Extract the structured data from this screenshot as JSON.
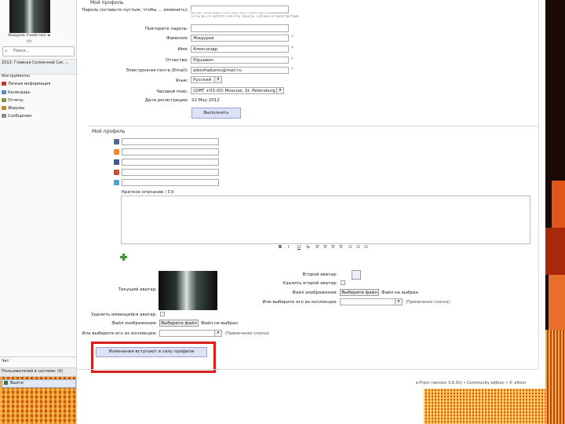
{
  "sidebar": {
    "avatar_label": "Жадуров (Свойства) ◂▸",
    "status": "(P)",
    "search_placeholder": "Поиск...",
    "section_title": "2012: Главная Солнечной Сис ...",
    "tools_title": "Инструменты",
    "nav": [
      {
        "label": "Личная информация",
        "icon": "profile-icon",
        "color": "#c0392b"
      },
      {
        "label": "Календарь",
        "icon": "calendar-icon",
        "color": "#5a8ac6"
      },
      {
        "label": "Отчеты",
        "icon": "reports-icon",
        "color": "#7a9a3c"
      },
      {
        "label": "Форумы",
        "icon": "forums-icon",
        "color": "#c08a2c"
      },
      {
        "label": "Сообщения",
        "icon": "messages-icon",
        "color": "#8c8c8c"
      }
    ],
    "online_title": "Чат",
    "online_label": "Пользователей в системе: (6)",
    "exit_label": "Выйти"
  },
  "overlay_title": "Мой профиль",
  "top_section": {
    "heading": "Мой профиль",
    "password_label": "Пароль (оставьте пустым, чтобы ... изменить):",
    "password_hint": "Если вы не хотите менять пароль, оставьте поле пустым",
    "password_repeat_label": "Повторите пароль:",
    "lastname_label": "Фамилия:",
    "lastname_value": "Жадуров",
    "firstname_label": "Имя:",
    "firstname_value": "Александр",
    "middlename_label": "Отчество:",
    "middlename_value": "Юрьевич",
    "email_label": "Электронная почта (Email):",
    "email_value": "alexzhadurov@mail.ru",
    "language_label": "Язык:",
    "language_value": "Русский",
    "timezone_label": "Часовой пояс:",
    "timezone_value": "(GMT +03:00) Moscow, St. Petersburg",
    "regdate_label": "Дата регистрации:",
    "regdate_value": "22 May 2012",
    "submit_label": "Выполнить"
  },
  "profile_section": {
    "heading": "Мой профиль",
    "social": [
      {
        "icon": "vkontakte-icon",
        "color": "#4a6d96"
      },
      {
        "icon": "odnoklassniki-icon",
        "color": "#f08a16"
      },
      {
        "icon": "facebook-icon",
        "color": "#3b5998"
      },
      {
        "icon": "google-plus-icon",
        "color": "#d6492f"
      },
      {
        "icon": "twitter-icon",
        "color": "#4ba6d8"
      }
    ],
    "cv_label": "Краткое описание / CV:",
    "toolbar": [
      "B",
      "I",
      "U",
      "⇆",
      "☰",
      "☰",
      "☰",
      "☰",
      "☷",
      "☷",
      "☷"
    ],
    "add_icon": "plus-icon",
    "current_avatar_label": "Текущий аватар:",
    "second_avatar_label": "Второй аватар:",
    "delete_second_label": "Удалить второй аватар:",
    "image_file_label": "Файл изображения:",
    "choose_file_label": "Выберите файл",
    "no_file_label": "Файл не выбран",
    "gallery_label": "Или выберите его из коллекции:",
    "gallery_hint": "(Примечание списка)",
    "delete_current_label": "Удалить имеющийся аватар:",
    "save_label": "Изменения вступают в силу профиля"
  },
  "footer_text": "e-Front (version 3.6.3h) • Community edition • © efront"
}
